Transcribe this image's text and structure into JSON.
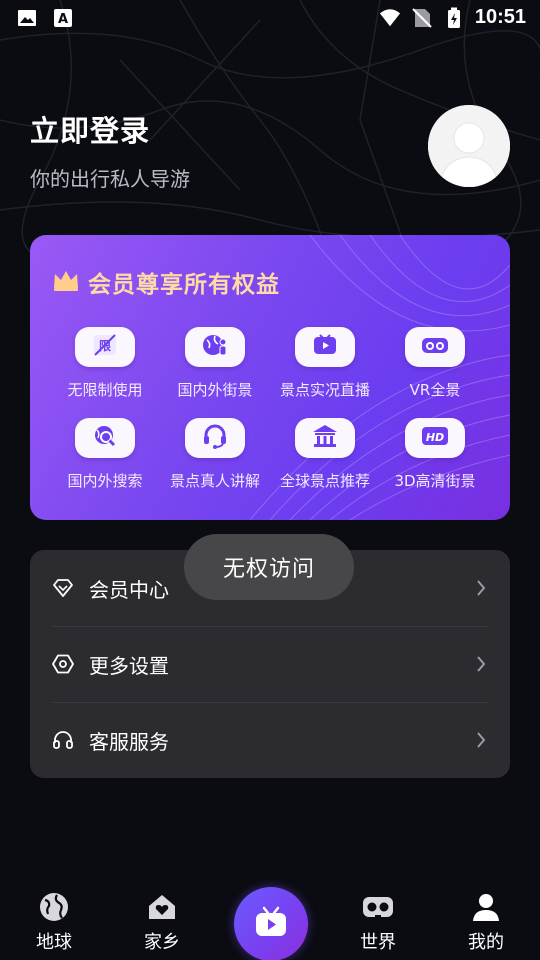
{
  "status_bar": {
    "time": "10:51",
    "left_icons": [
      "image-icon",
      "text-a-icon"
    ],
    "right_icons": [
      "wifi-icon",
      "no-sim-icon",
      "battery-charging-icon"
    ]
  },
  "header": {
    "title": "立即登录",
    "subtitle": "你的出行私人导游",
    "avatar_icon": "user-placeholder-icon"
  },
  "vip_card": {
    "title": "会员尊享所有权益",
    "title_icon": "crown-icon",
    "features": [
      {
        "label": "无限制使用",
        "icon": "unlimited-icon"
      },
      {
        "label": "国内外街景",
        "icon": "globe-person-icon"
      },
      {
        "label": "景点实况直播",
        "icon": "live-play-icon"
      },
      {
        "label": "VR全景",
        "icon": "vr-goggles-icon"
      },
      {
        "label": "国内外搜索",
        "icon": "search-globe-icon"
      },
      {
        "label": "景点真人讲解",
        "icon": "headset-icon"
      },
      {
        "label": "全球景点推荐",
        "icon": "temple-icon"
      },
      {
        "label": "3D高清街景",
        "icon": "hd-icon"
      }
    ],
    "hd_badge_text": "HD",
    "colors": {
      "gradient_start": "#9a59f5",
      "gradient_end": "#7a2fe0",
      "title": "#ffd9a6"
    }
  },
  "menu": {
    "items": [
      {
        "label": "会员中心",
        "icon": "diamond-icon"
      },
      {
        "label": "更多设置",
        "icon": "hexagon-settings-icon"
      },
      {
        "label": "客服服务",
        "icon": "headphones-icon"
      }
    ]
  },
  "toast": {
    "text": "无权访问"
  },
  "bottom_nav": {
    "tabs": [
      {
        "label": "地球",
        "icon": "earth-icon"
      },
      {
        "label": "家乡",
        "icon": "home-heart-icon"
      },
      {
        "label": "",
        "icon": "tv-play-icon"
      },
      {
        "label": "世界",
        "icon": "vr-icon"
      },
      {
        "label": "我的",
        "icon": "person-icon"
      }
    ],
    "active_tab": "我的",
    "center_color": "#7a3ff0"
  }
}
